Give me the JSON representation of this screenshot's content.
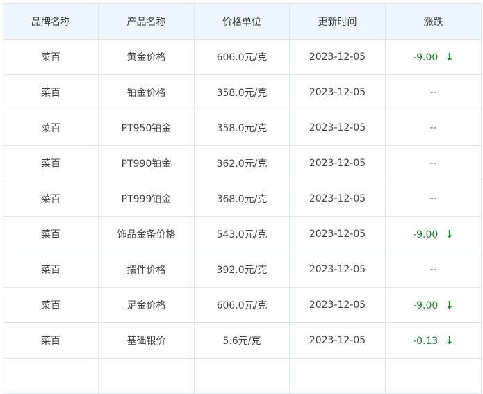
{
  "table": {
    "headers": [
      "品牌名称",
      "产品名称",
      "价格单位",
      "更新时间",
      "涨跌"
    ],
    "rows": [
      {
        "brand": "菜百",
        "product": "黄金价格",
        "price": "606.0元/克",
        "date": "2023-12-05",
        "change": "-9.00",
        "direction": "down"
      },
      {
        "brand": "菜百",
        "product": "铂金价格",
        "price": "358.0元/克",
        "date": "2023-12-05",
        "change": "--",
        "direction": "flat"
      },
      {
        "brand": "菜百",
        "product": "PT950铂金",
        "price": "358.0元/克",
        "date": "2023-12-05",
        "change": "--",
        "direction": "flat"
      },
      {
        "brand": "菜百",
        "product": "PT990铂金",
        "price": "362.0元/克",
        "date": "2023-12-05",
        "change": "--",
        "direction": "flat"
      },
      {
        "brand": "菜百",
        "product": "PT999铂金",
        "price": "368.0元/克",
        "date": "2023-12-05",
        "change": "--",
        "direction": "flat"
      },
      {
        "brand": "菜百",
        "product": "饰品金条价格",
        "price": "543.0元/克",
        "date": "2023-12-05",
        "change": "-9.00",
        "direction": "down"
      },
      {
        "brand": "菜百",
        "product": "摆件价格",
        "price": "392.0元/克",
        "date": "2023-12-05",
        "change": "--",
        "direction": "flat"
      },
      {
        "brand": "菜百",
        "product": "足金价格",
        "price": "606.0元/克",
        "date": "2023-12-05",
        "change": "-9.00",
        "direction": "down"
      },
      {
        "brand": "菜百",
        "product": "基础银价",
        "price": "5.6元/克",
        "date": "2023-12-05",
        "change": "-0.13",
        "direction": "down"
      },
      {
        "brand": "",
        "product": "",
        "price": "",
        "date": "",
        "change": "",
        "direction": "flat"
      }
    ],
    "down_arrow_icon": "arrow-down-icon",
    "colors": {
      "header_bg": "#eef6ff",
      "border": "#dde7f0",
      "down": "#1a8a2a"
    }
  }
}
